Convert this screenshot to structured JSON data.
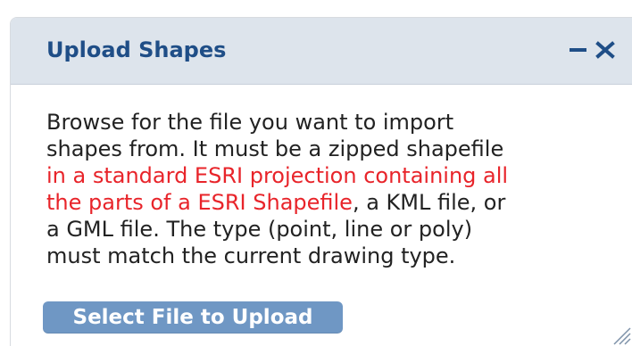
{
  "dialog": {
    "title": "Upload Shapes",
    "minimize_icon": "minimize-icon",
    "close_icon": "close-icon",
    "description": {
      "line1": "Browse for the file you want to import",
      "line2": "shapes from. It must be a zipped shapefile",
      "line3": "in a standard ESRI projection containing all",
      "line4_red": "the parts of a ESRI Shapefile",
      "line4_rest": ", a KML file, or",
      "line5": "a GML file. The type (point, line or poly)",
      "line6": "must match the current drawing type."
    },
    "upload_button_label": "Select File to Upload",
    "resize_icon": "resize-grip-icon"
  },
  "colors": {
    "title": "#1f4e87",
    "titlebar_bg": "#dde4ec",
    "warning_text": "#e8242a",
    "button_bg": "#6f97c4",
    "button_text": "#ffffff"
  }
}
